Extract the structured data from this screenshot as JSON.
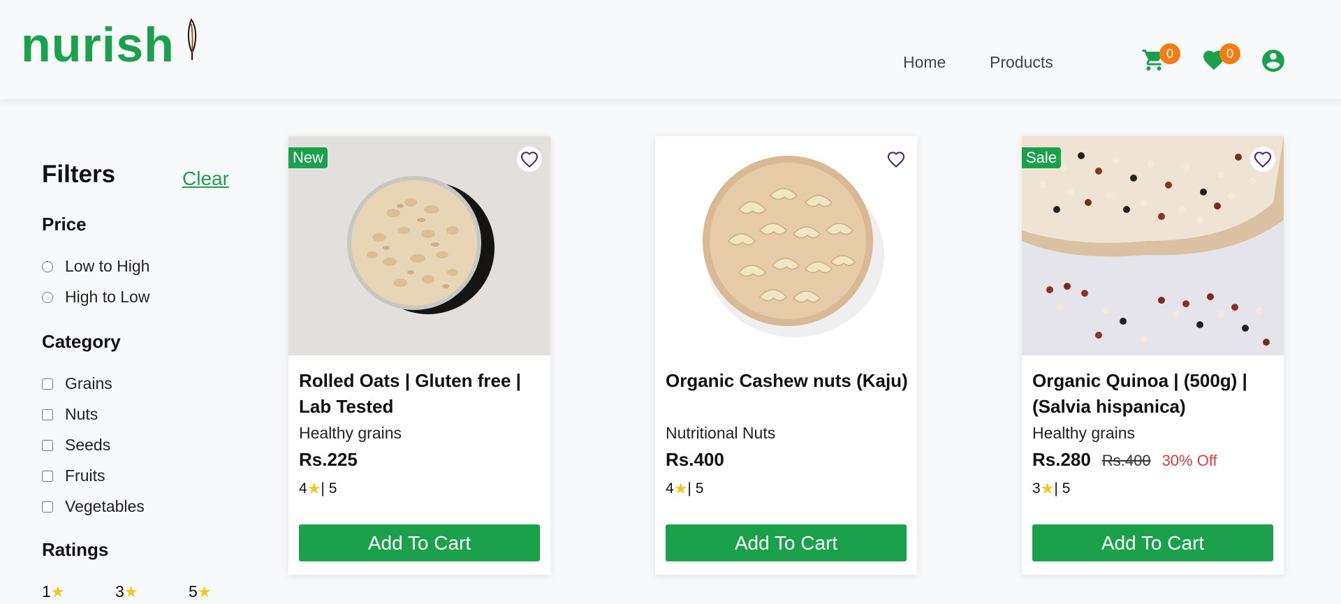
{
  "brand": {
    "name": "nurish",
    "color": "#1ba14c"
  },
  "nav": {
    "home": "Home",
    "products": "Products"
  },
  "header_icons": {
    "cart_count": "0",
    "wishlist_count": "0",
    "cart_icon": "cart-icon",
    "heart_icon": "heart-icon",
    "profile_icon": "user-circle-icon",
    "badge_color": "#f57c12"
  },
  "filters": {
    "title": "Filters",
    "clear": "Clear",
    "price": {
      "title": "Price",
      "options": [
        "Low to High",
        "High to Low"
      ]
    },
    "category": {
      "title": "Category",
      "options": [
        "Grains",
        "Nuts",
        "Seeds",
        "Fruits",
        "Vegetables"
      ]
    },
    "ratings": {
      "title": "Ratings",
      "options": [
        "1",
        "3",
        "5"
      ]
    }
  },
  "products": [
    {
      "tag": "New",
      "title": "Rolled Oats | Gluten free | Lab Tested",
      "category": "Healthy grains",
      "price": "Rs.225",
      "old_price": "",
      "discount": "",
      "rating": "4",
      "rating_max": "| 5",
      "button": "Add To Cart"
    },
    {
      "tag": "",
      "title": "Organic Cashew nuts (Kaju)",
      "category": "Nutritional Nuts",
      "price": "Rs.400",
      "old_price": "",
      "discount": "",
      "rating": "4",
      "rating_max": "| 5",
      "button": "Add To Cart"
    },
    {
      "tag": "Sale",
      "title": "Organic Quinoa | (500g) | (Salvia hispanica)",
      "category": "Healthy grains",
      "price": "Rs.280",
      "old_price": "Rs.400",
      "discount": "30% Off",
      "rating": "3",
      "rating_max": "| 5",
      "button": "Add To Cart"
    }
  ]
}
